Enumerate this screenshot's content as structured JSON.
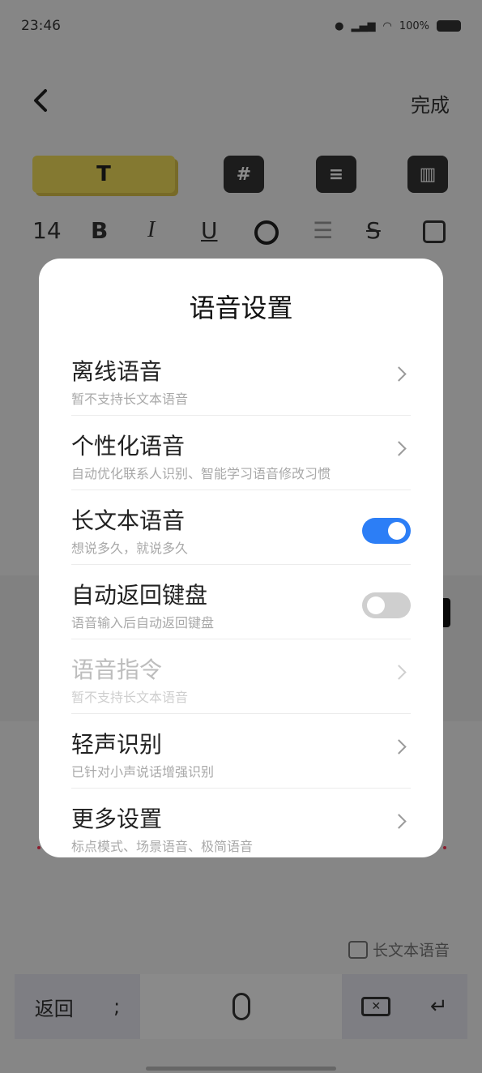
{
  "status_bar": {
    "time": "23:46",
    "battery": "100%"
  },
  "top_nav": {
    "done_label": "完成"
  },
  "style_chips": {
    "text_label": "T",
    "hash_label": "#",
    "list_label": "≡",
    "grid_label": "▥"
  },
  "format_bar": {
    "font_size": "14",
    "bold": "B",
    "italic": "I",
    "underline": "U",
    "align": "☰",
    "strike": "S"
  },
  "keyboard": {
    "back_label": "返回",
    "semicolon": ";",
    "voice_mode_label": "长文本语音"
  },
  "dialog": {
    "title": "语音设置",
    "items": [
      {
        "title": "离线语音",
        "desc": "暂不支持长文本语音",
        "control": "chevron",
        "disabled": false
      },
      {
        "title": "个性化语音",
        "desc": "自动优化联系人识别、智能学习语音修改习惯",
        "control": "chevron",
        "disabled": false
      },
      {
        "title": "长文本语音",
        "desc": "想说多久，就说多久",
        "control": "toggle",
        "on": true
      },
      {
        "title": "自动返回键盘",
        "desc": "语音输入后自动返回键盘",
        "control": "toggle",
        "on": false
      },
      {
        "title": "语音指令",
        "desc": "暂不支持长文本语音",
        "control": "chevron",
        "disabled": true
      },
      {
        "title": "轻声识别",
        "desc": "已针对小声说话增强识别",
        "control": "chevron",
        "disabled": false
      },
      {
        "title": "更多设置",
        "desc": "标点模式、场景语音、极简语音",
        "control": "chevron",
        "disabled": false
      }
    ]
  },
  "colors": {
    "accent": "#2c7ef6",
    "highlight": "#f1dc5a"
  }
}
